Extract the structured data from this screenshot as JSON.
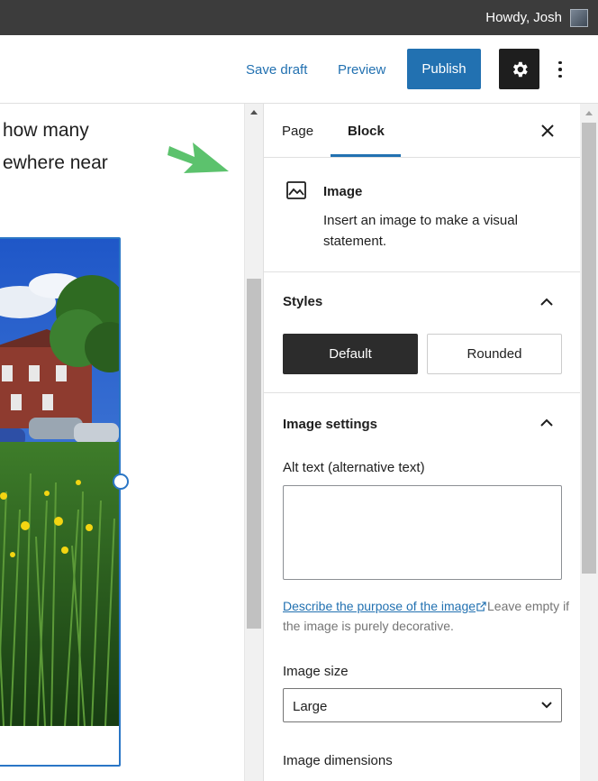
{
  "admin_bar": {
    "greeting": "Howdy, Josh"
  },
  "toolbar": {
    "save_draft_label": "Save draft",
    "preview_label": "Preview",
    "publish_label": "Publish"
  },
  "canvas": {
    "paragraph_lines": [
      "how many",
      "ewhere near"
    ]
  },
  "sidebar": {
    "tabs": [
      {
        "label": "Page",
        "active": false
      },
      {
        "label": "Block",
        "active": true
      }
    ],
    "block": {
      "title": "Image",
      "description": "Insert an image to make a visual statement."
    },
    "styles": {
      "title": "Styles",
      "options": [
        {
          "label": "Default",
          "selected": true
        },
        {
          "label": "Rounded",
          "selected": false
        }
      ]
    },
    "image_settings": {
      "title": "Image settings",
      "alt_label": "Alt text (alternative text)",
      "alt_value": "",
      "help_link": "Describe the purpose of the image",
      "help_text": "Leave empty if the image is purely decorative.",
      "size_label": "Image size",
      "size_value": "Large",
      "dimensions_label": "Image dimensions"
    }
  },
  "colors": {
    "accent": "#2271b1",
    "selection": "#2a76c6",
    "dark": "#1e1e1e",
    "arrow": "#5cc26d"
  }
}
